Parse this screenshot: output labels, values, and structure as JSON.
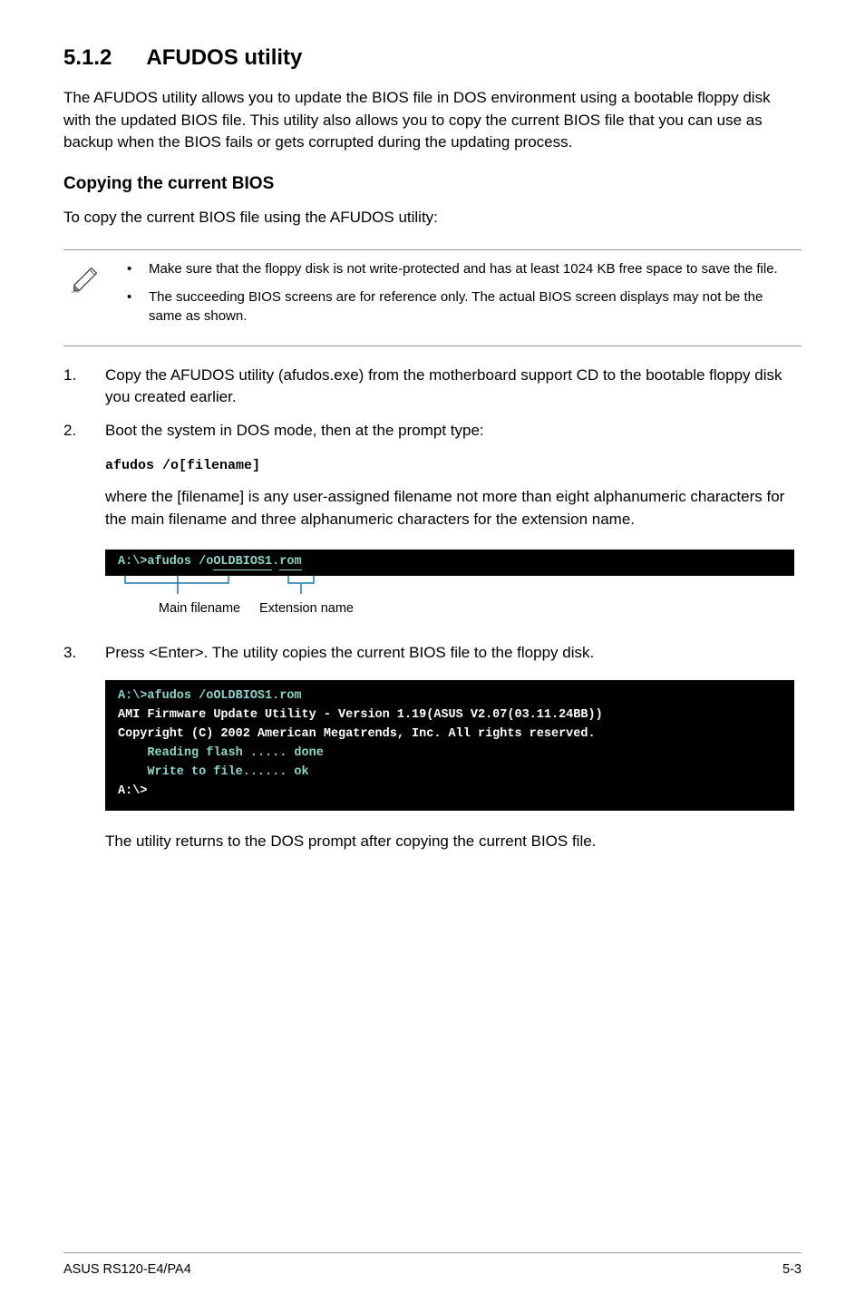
{
  "section": {
    "number": "5.1.2",
    "title": "AFUDOS utility"
  },
  "intro": "The AFUDOS utility allows you to update the BIOS file in DOS environment using a bootable floppy disk with the updated BIOS file. This utility also allows you to copy the current BIOS file that you can use as backup when the BIOS fails or gets corrupted during the updating process.",
  "copying": {
    "heading": "Copying the current BIOS",
    "intro": "To copy the current BIOS file using the AFUDOS utility:"
  },
  "notes": {
    "n1": "Make sure that the floppy disk is not write-protected and has at least 1024 KB free space to save the file.",
    "n2": "The succeeding BIOS screens are for reference only. The actual BIOS screen displays may not be the same as shown."
  },
  "steps": {
    "s1_num": "1.",
    "s1": "Copy the AFUDOS utility (afudos.exe) from the motherboard support CD to the bootable floppy disk you created earlier.",
    "s2_num": "2.",
    "s2": "Boot the system in DOS mode, then at the prompt type:",
    "code": "afudos /o[filename]",
    "code_desc": "where the [filename] is any user-assigned filename not more than eight alphanumeric characters  for the main filename and three alphanumeric characters for the extension name.",
    "s3_num": "3.",
    "s3": "Press <Enter>. The utility copies the current BIOS file to the floppy disk."
  },
  "term1": {
    "prefix": "A:\\>afudos /o",
    "main": "OLDBIOS1",
    "dot": ".",
    "ext": "rom"
  },
  "labels": {
    "main": "Main filename",
    "ext": "Extension name"
  },
  "term2": {
    "l1": "A:\\>afudos /oOLDBIOS1.rom",
    "l2": "AMI Firmware Update Utility - Version 1.19(ASUS V2.07(03.11.24BB))",
    "l3": "Copyright (C) 2002 American Megatrends, Inc. All rights reserved.",
    "l4": "    Reading flash ..... done",
    "l5": "    Write to file...... ok",
    "l6": "A:\\>"
  },
  "closing": "The utility returns to the DOS prompt after copying the current BIOS file.",
  "footer": {
    "left": "ASUS RS120-E4/PA4",
    "right": "5-3"
  }
}
